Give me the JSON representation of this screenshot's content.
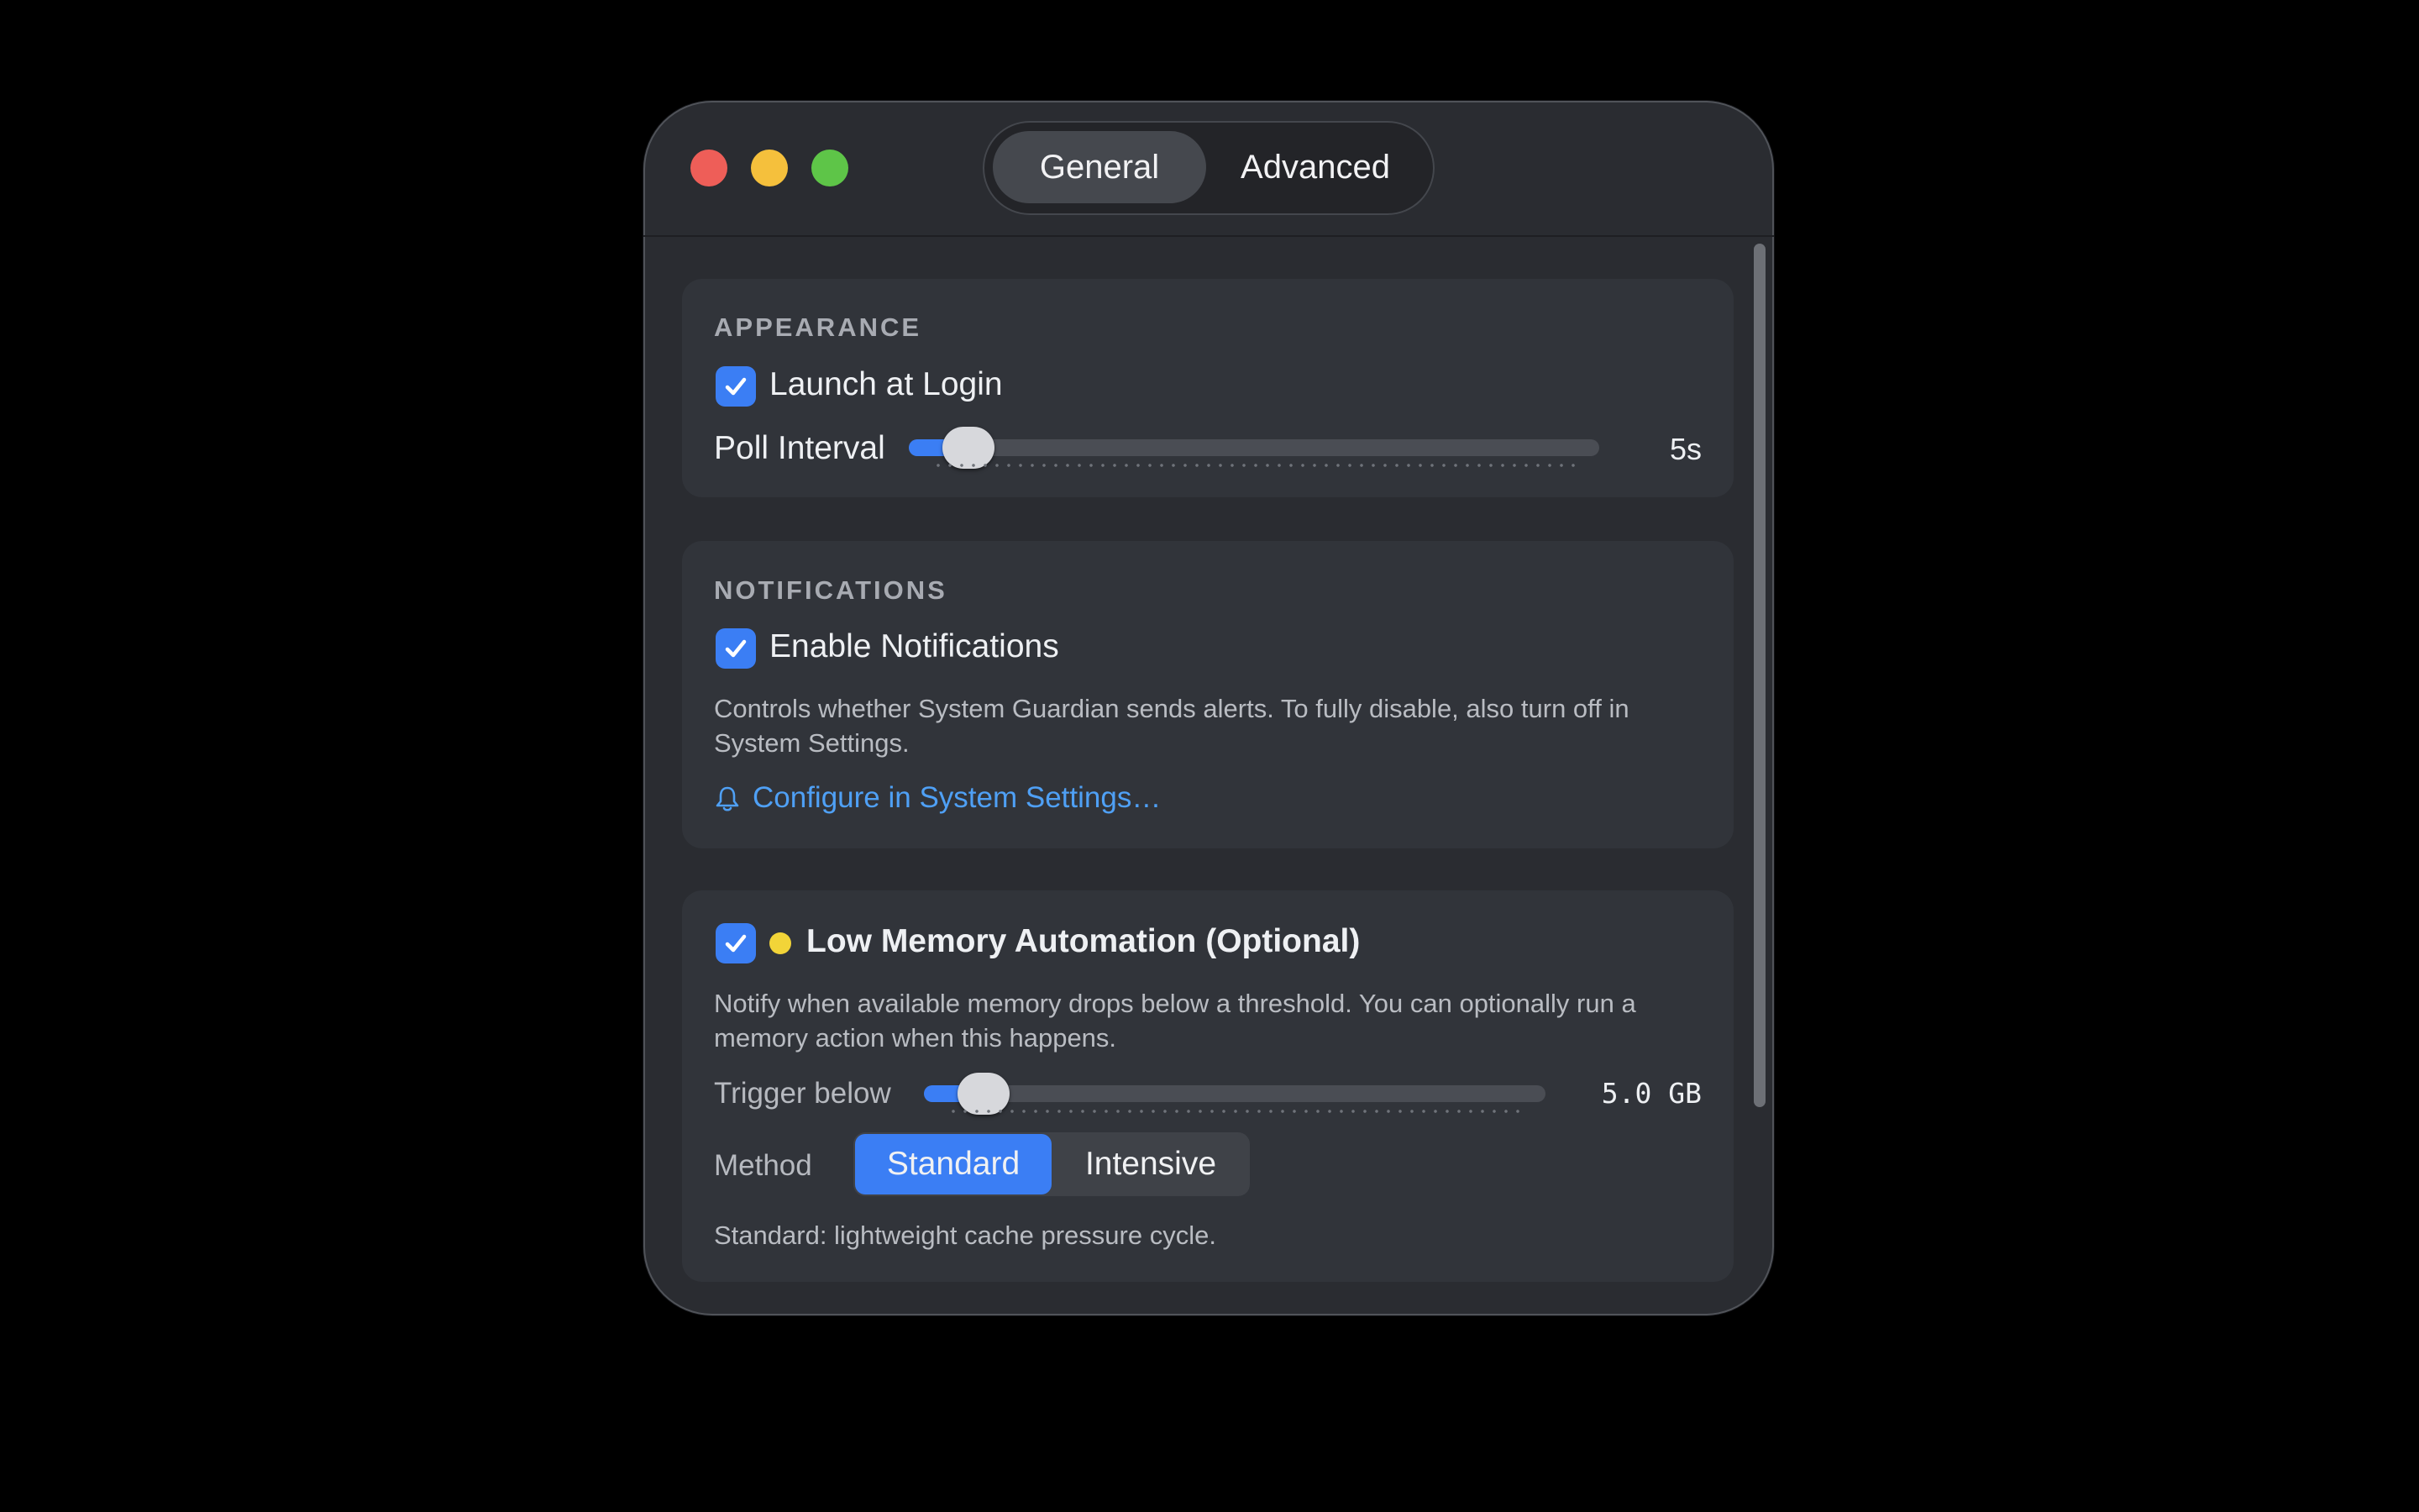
{
  "window": {
    "tabs": [
      {
        "label": "General",
        "selected": true
      },
      {
        "label": "Advanced",
        "selected": false
      }
    ]
  },
  "appearance": {
    "section_title": "APPEARANCE",
    "launch_at_login": {
      "label": "Launch at Login",
      "checked": true
    },
    "poll_interval": {
      "label": "Poll Interval",
      "value_text": "5s",
      "fill_fraction": 0.07
    }
  },
  "notifications": {
    "section_title": "NOTIFICATIONS",
    "enable": {
      "label": "Enable Notifications",
      "checked": true
    },
    "description": "Controls whether System Guardian sends alerts. To fully disable, also turn off in System Settings.",
    "configure_link": "Configure in System Settings…",
    "configure_icon": "bell-icon"
  },
  "low_memory": {
    "title": "Low Memory Automation (Optional)",
    "checked": true,
    "status_color": "#f2d438",
    "description": "Notify when available memory drops below a threshold. You can optionally run a memory action when this happens.",
    "trigger": {
      "label": "Trigger below",
      "value_text": "5.0 GB",
      "fill_fraction": 0.08
    },
    "method": {
      "label": "Method",
      "options": [
        "Standard",
        "Intensive"
      ],
      "selected": "Standard"
    },
    "method_description": "Standard: lightweight cache pressure cycle."
  },
  "colors": {
    "accent": "#3b7ef4",
    "link": "#4fa0f5",
    "close": "#ee5e58",
    "minimize": "#f5c03c",
    "maximize": "#5ec548"
  }
}
